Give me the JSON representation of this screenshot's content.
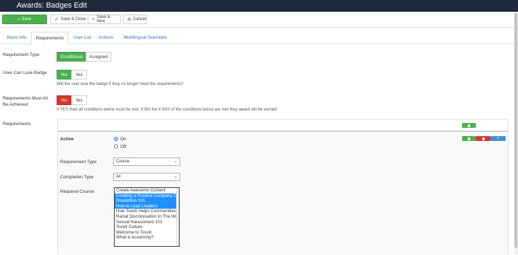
{
  "window": {
    "title": "Awards: Badges Edit"
  },
  "toolbar": {
    "save_label": "Save",
    "save_close_label": "Save & Close",
    "save_new_label": "Save & New",
    "cancel_label": "Cancel"
  },
  "tabs": [
    {
      "label": "Basic Info",
      "active": false
    },
    {
      "label": "Requirements",
      "active": true
    },
    {
      "label": "User List",
      "active": false
    },
    {
      "label": "Actions",
      "active": false
    },
    {
      "label": "Multilingual Overrides",
      "active": false
    }
  ],
  "requirement_type": {
    "label": "Requirement Type",
    "options": [
      "Conditional",
      "Assigned"
    ],
    "selected": "Conditional"
  },
  "can_lose_badge": {
    "label": "User Can Lose Badge",
    "options": [
      "No",
      "Yes"
    ],
    "selected": "No",
    "help": "Will the user lose the badge if they no longer meet the requirements?"
  },
  "must_all_achieved": {
    "label": "Requirements Must All Be Achieved",
    "options": [
      "No",
      "Yes"
    ],
    "selected": "No",
    "help": "If YES then all conditions below must be met. If NO the if ANY of the conditions below are met they award will be earned"
  },
  "requirements": {
    "label": "Requirements",
    "active_label": "Active",
    "active_options": [
      "On",
      "Off"
    ],
    "active_selected": "On",
    "requirement_type_label": "Requirement Type",
    "requirement_type_value": "Course",
    "completion_type_label": "Completion Type",
    "completion_type_value": "All",
    "required_course_label": "Required Course",
    "courses": [
      {
        "name": "Create Awesome Content",
        "selected": false
      },
      {
        "name": "Creating a Positive Company Culture",
        "selected": true
      },
      {
        "name": "Disabilities 101",
        "selected": true
      },
      {
        "name": "How to Lead Leaders",
        "selected": true
      },
      {
        "name": "How Tovuti Helps Communities",
        "selected": false
      },
      {
        "name": "Racial Discrimination In The Workplace",
        "selected": false
      },
      {
        "name": "Sexual Harassment 101",
        "selected": false
      },
      {
        "name": "Tovuti Culture",
        "selected": false
      },
      {
        "name": "Welcome to Tovuti",
        "selected": false
      },
      {
        "name": "What is eLearning?",
        "selected": false
      }
    ]
  },
  "colors": {
    "green": "#4caf50",
    "red": "#d9342b",
    "blue": "#3b8ed8",
    "header": "#1c2a3a"
  }
}
